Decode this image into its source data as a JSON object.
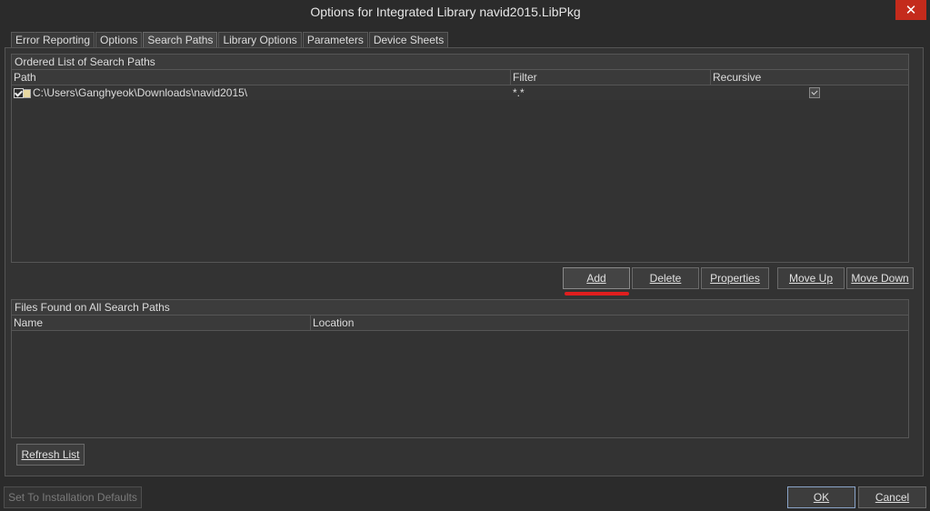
{
  "window": {
    "title": "Options for Integrated Library navid2015.LibPkg",
    "close_glyph": "✕"
  },
  "tabs": [
    {
      "label": "Error Reporting"
    },
    {
      "label": "Options"
    },
    {
      "label": "Search Paths",
      "active": true
    },
    {
      "label": "Library Options"
    },
    {
      "label": "Parameters"
    },
    {
      "label": "Device Sheets"
    }
  ],
  "search_paths": {
    "title": "Ordered List of Search Paths",
    "columns": [
      "Path",
      "Filter",
      "Recursive"
    ],
    "rows": [
      {
        "path": "C:\\Users\\Ganghyeok\\Downloads\\navid2015\\",
        "filter": "*.*",
        "recursive": true
      }
    ]
  },
  "path_buttons": {
    "add": "Add",
    "delete": "Delete",
    "properties": "Properties",
    "move_up": "Move Up",
    "move_down": "Move Down"
  },
  "files_found": {
    "title": "Files Found on All Search Paths",
    "columns": [
      "Name",
      "Location"
    ]
  },
  "refresh_label": "Refresh List",
  "footer": {
    "defaults_label": "Set To Installation Defaults",
    "ok_label": "OK",
    "cancel_label": "Cancel"
  },
  "colors": {
    "background": "#2b2b2b",
    "close_button": "#c42b1c",
    "annotation_underline": "#e01e1e"
  },
  "icons": {
    "close": "close-icon",
    "row_checkbox": "checkbox-icon",
    "path_folder": "folder-icon",
    "recursive_dropdown": "checkmark-icon"
  }
}
